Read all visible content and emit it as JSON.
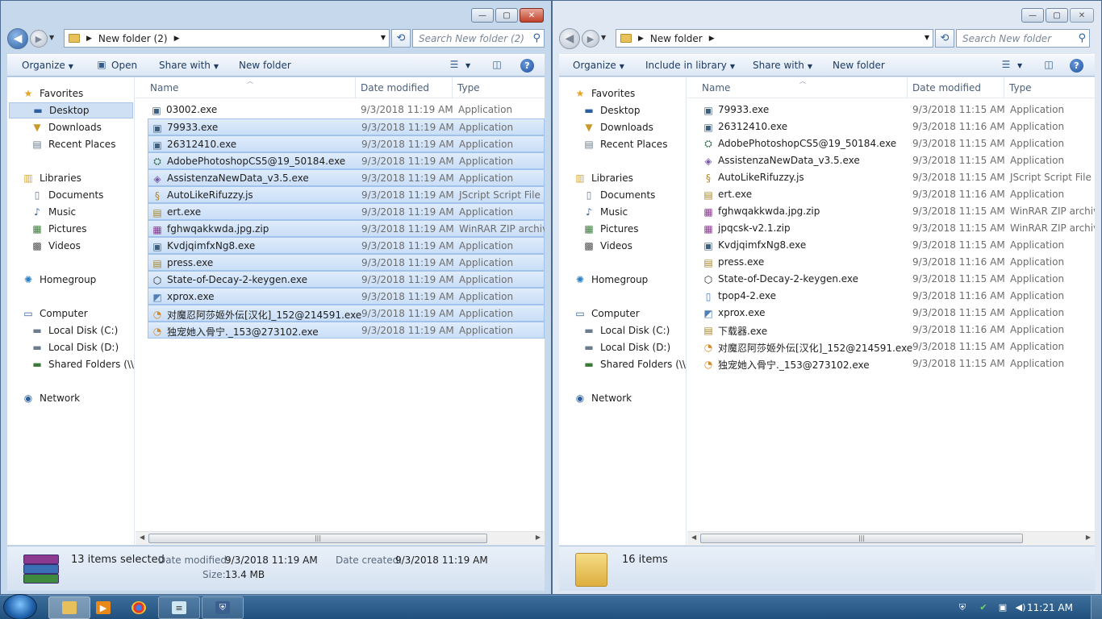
{
  "left": {
    "caption": {
      "min": "—",
      "max": "▢",
      "close": "✕"
    },
    "address": {
      "crumb": "New folder (2)"
    },
    "search_placeholder": "Search New folder (2)",
    "toolbar": {
      "organize": "Organize",
      "open": "Open",
      "share": "Share with",
      "new_folder": "New folder"
    },
    "columns": {
      "name": "Name",
      "date": "Date modified",
      "type": "Type"
    },
    "nav": {
      "favorites": "Favorites",
      "desktop": "Desktop",
      "downloads": "Downloads",
      "recent": "Recent Places",
      "libraries": "Libraries",
      "documents": "Documents",
      "music": "Music",
      "pictures": "Pictures",
      "videos": "Videos",
      "homegroup": "Homegroup",
      "computer": "Computer",
      "local_c": "Local Disk (C:)",
      "local_d": "Local Disk (D:)",
      "shared": "Shared Folders (\\\\vn",
      "network": "Network"
    },
    "files": [
      {
        "name": "03002.exe",
        "date": "9/3/2018 11:19 AM",
        "type": "Application",
        "icon": "app-icon",
        "selected": false
      },
      {
        "name": "79933.exe",
        "date": "9/3/2018 11:19 AM",
        "type": "Application",
        "icon": "app-icon",
        "selected": true
      },
      {
        "name": "26312410.exe",
        "date": "9/3/2018 11:19 AM",
        "type": "Application",
        "icon": "app-icon",
        "selected": true
      },
      {
        "name": "AdobePhotoshopCS5@19_50184.exe",
        "date": "9/3/2018 11:19 AM",
        "type": "Application",
        "icon": "installer-icon",
        "selected": true
      },
      {
        "name": "AssistenzaNewData_v3.5.exe",
        "date": "9/3/2018 11:19 AM",
        "type": "Application",
        "icon": "setup-icon",
        "selected": true
      },
      {
        "name": "AutoLikeRifuzzy.js",
        "date": "9/3/2018 11:19 AM",
        "type": "JScript Script File",
        "icon": "script-icon",
        "selected": true
      },
      {
        "name": "ert.exe",
        "date": "9/3/2018 11:19 AM",
        "type": "Application",
        "icon": "press-icon",
        "selected": true
      },
      {
        "name": "fghwqakkwda.jpg.zip",
        "date": "9/3/2018 11:19 AM",
        "type": "WinRAR ZIP archive",
        "icon": "winrar-icon",
        "selected": true
      },
      {
        "name": "KvdjqimfxNg8.exe",
        "date": "9/3/2018 11:19 AM",
        "type": "Application",
        "icon": "app-icon",
        "selected": true
      },
      {
        "name": "press.exe",
        "date": "9/3/2018 11:19 AM",
        "type": "Application",
        "icon": "press-icon",
        "selected": true
      },
      {
        "name": "State-of-Decay-2-keygen.exe",
        "date": "9/3/2018 11:19 AM",
        "type": "Application",
        "icon": "cube-icon",
        "selected": true
      },
      {
        "name": "xprox.exe",
        "date": "9/3/2018 11:19 AM",
        "type": "Application",
        "icon": "xprox-icon",
        "selected": true
      },
      {
        "name": "对魔忍阿莎姬外伝[汉化]_152@214591.exe",
        "date": "9/3/2018 11:19 AM",
        "type": "Application",
        "icon": "pie-icon",
        "selected": true
      },
      {
        "name": "独宠她入骨宁._153@273102.exe",
        "date": "9/3/2018 11:19 AM",
        "type": "Application",
        "icon": "pie-icon",
        "selected": true
      }
    ],
    "details": {
      "count": "13 items selected",
      "modified_label": "Date modified:",
      "modified_value": "9/3/2018 11:19 AM",
      "created_label": "Date created:",
      "created_value": "9/3/2018 11:19 AM",
      "size_label": "Size:",
      "size_value": "13.4 MB"
    }
  },
  "right": {
    "caption": {
      "min": "—",
      "max": "▢",
      "close": "✕"
    },
    "address": {
      "crumb": "New folder"
    },
    "search_placeholder": "Search New folder",
    "toolbar": {
      "organize": "Organize",
      "include": "Include in library",
      "share": "Share with",
      "new_folder": "New folder"
    },
    "columns": {
      "name": "Name",
      "date": "Date modified",
      "type": "Type"
    },
    "nav": {
      "favorites": "Favorites",
      "desktop": "Desktop",
      "downloads": "Downloads",
      "recent": "Recent Places",
      "libraries": "Libraries",
      "documents": "Documents",
      "music": "Music",
      "pictures": "Pictures",
      "videos": "Videos",
      "homegroup": "Homegroup",
      "computer": "Computer",
      "local_c": "Local Disk (C:)",
      "local_d": "Local Disk (D:)",
      "shared": "Shared Folders (\\\\vn",
      "network": "Network"
    },
    "files": [
      {
        "name": "79933.exe",
        "date": "9/3/2018 11:15 AM",
        "type": "Application",
        "icon": "app-icon"
      },
      {
        "name": "26312410.exe",
        "date": "9/3/2018 11:16 AM",
        "type": "Application",
        "icon": "app-icon"
      },
      {
        "name": "AdobePhotoshopCS5@19_50184.exe",
        "date": "9/3/2018 11:15 AM",
        "type": "Application",
        "icon": "installer-icon"
      },
      {
        "name": "AssistenzaNewData_v3.5.exe",
        "date": "9/3/2018 11:15 AM",
        "type": "Application",
        "icon": "setup-icon"
      },
      {
        "name": "AutoLikeRifuzzy.js",
        "date": "9/3/2018 11:15 AM",
        "type": "JScript Script File",
        "icon": "script-icon"
      },
      {
        "name": "ert.exe",
        "date": "9/3/2018 11:16 AM",
        "type": "Application",
        "icon": "press-icon"
      },
      {
        "name": "fghwqakkwda.jpg.zip",
        "date": "9/3/2018 11:15 AM",
        "type": "WinRAR ZIP archive",
        "icon": "winrar-icon"
      },
      {
        "name": "jpqcsk-v2.1.zip",
        "date": "9/3/2018 11:15 AM",
        "type": "WinRAR ZIP archive",
        "icon": "winrar-icon"
      },
      {
        "name": "KvdjqimfxNg8.exe",
        "date": "9/3/2018 11:15 AM",
        "type": "Application",
        "icon": "app-icon"
      },
      {
        "name": "press.exe",
        "date": "9/3/2018 11:16 AM",
        "type": "Application",
        "icon": "press-icon"
      },
      {
        "name": "State-of-Decay-2-keygen.exe",
        "date": "9/3/2018 11:15 AM",
        "type": "Application",
        "icon": "cube-icon"
      },
      {
        "name": "tpop4-2.exe",
        "date": "9/3/2018 11:16 AM",
        "type": "Application",
        "icon": "doc-icon"
      },
      {
        "name": "xprox.exe",
        "date": "9/3/2018 11:15 AM",
        "type": "Application",
        "icon": "xprox-icon"
      },
      {
        "name": "下载器.exe",
        "date": "9/3/2018 11:16 AM",
        "type": "Application",
        "icon": "press-icon"
      },
      {
        "name": "对魔忍阿莎姬外伝[汉化]_152@214591.exe",
        "date": "9/3/2018 11:15 AM",
        "type": "Application",
        "icon": "pie-icon"
      },
      {
        "name": "独宠她入骨宁._153@273102.exe",
        "date": "9/3/2018 11:15 AM",
        "type": "Application",
        "icon": "pie-icon"
      }
    ],
    "details": {
      "count": "16 items"
    }
  },
  "taskbar": {
    "clock": "11:21 AM"
  },
  "colors": {
    "selection": "#cfe3f8",
    "window_frame": "#c6d8ec",
    "taskbar": "#2a5a88"
  }
}
